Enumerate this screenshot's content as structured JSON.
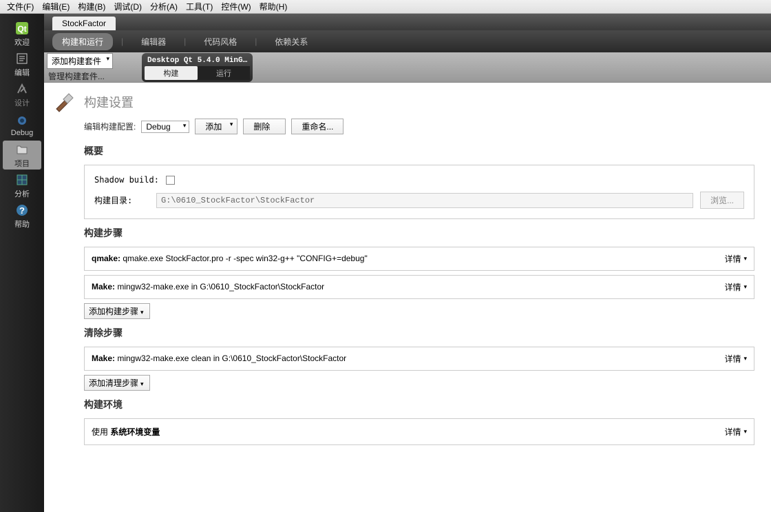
{
  "menubar": [
    "文件(F)",
    "编辑(E)",
    "构建(B)",
    "调试(D)",
    "分析(A)",
    "工具(T)",
    "控件(W)",
    "帮助(H)"
  ],
  "sidebar": [
    {
      "label": "欢迎",
      "name": "welcome"
    },
    {
      "label": "编辑",
      "name": "edit"
    },
    {
      "label": "设计",
      "name": "design"
    },
    {
      "label": "Debug",
      "name": "debug"
    },
    {
      "label": "项目",
      "name": "projects",
      "active": true
    },
    {
      "label": "分析",
      "name": "analyze"
    },
    {
      "label": "帮助",
      "name": "help"
    }
  ],
  "project_tab": "StockFactor",
  "subtabs": {
    "build_run": "构建和运行",
    "editor": "编辑器",
    "code_style": "代码风格",
    "dependencies": "依赖关系"
  },
  "kit": {
    "add_kit": "添加构建套件",
    "manage_kits": "管理构建套件...",
    "target_name": "Desktop Qt 5.4.0 MinG…",
    "tab_build": "构建",
    "tab_run": "运行"
  },
  "settings": {
    "title": "构建设置",
    "config_label": "编辑构建配置:",
    "config_value": "Debug",
    "add_btn": "添加",
    "remove_btn": "删除",
    "rename_btn": "重命名..."
  },
  "overview": {
    "title": "概要",
    "shadow_build": "Shadow build:",
    "build_dir_label": "构建目录:",
    "build_dir_value": "G:\\0610_StockFactor\\StockFactor",
    "browse": "浏览..."
  },
  "build_steps": {
    "title": "构建步骤",
    "qmake_label": "qmake:",
    "qmake_cmd": " qmake.exe StockFactor.pro -r -spec win32-g++ \"CONFIG+=debug\"",
    "make_label": "Make:",
    "make_cmd": " mingw32-make.exe in G:\\0610_StockFactor\\StockFactor",
    "details": "详情",
    "add_step": "添加构建步骤"
  },
  "clean_steps": {
    "title": "清除步骤",
    "make_label": "Make:",
    "make_cmd": " mingw32-make.exe clean in G:\\0610_StockFactor\\StockFactor",
    "details": "详情",
    "add_step": "添加清理步骤"
  },
  "build_env": {
    "title": "构建环境",
    "use_label": "使用 ",
    "env_label": "系统环境变量",
    "details": "详情"
  }
}
